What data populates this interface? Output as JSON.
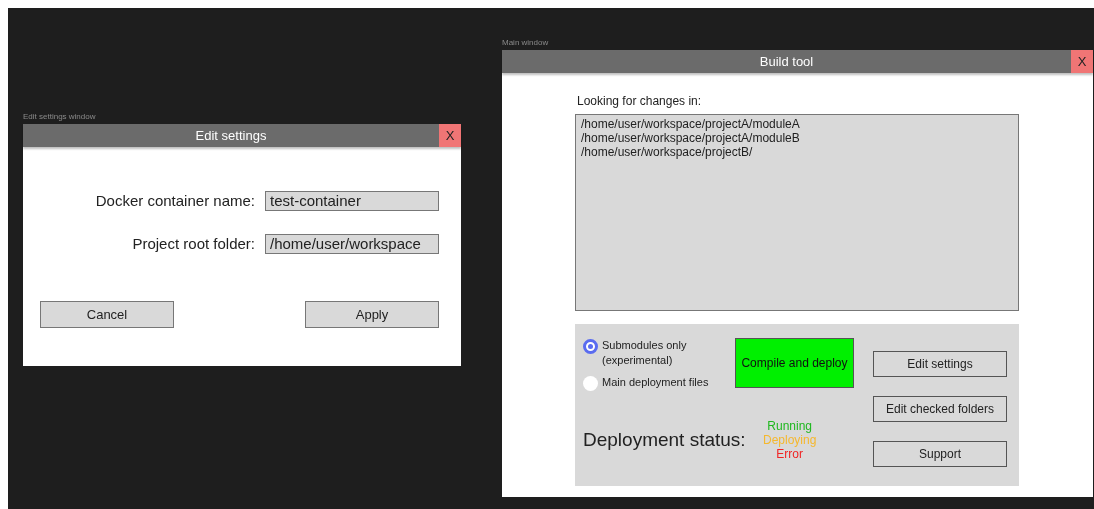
{
  "settings_window": {
    "canvas_label": "Edit settings window",
    "title": "Edit settings",
    "close": "X",
    "fields": [
      {
        "label": "Docker container name:",
        "value": "test-container"
      },
      {
        "label": "Project root folder:",
        "value": "/home/user/workspace"
      }
    ],
    "buttons": [
      "Cancel",
      "Apply"
    ]
  },
  "main_window": {
    "canvas_label": "Main window",
    "title": "Build tool",
    "close": "X",
    "folders_label": "Looking for changes in:",
    "folders": [
      "/home/user/workspace/projectA/moduleA",
      "/home/user/workspace/projectA/moduleB",
      "/home/user/workspace/projectB/"
    ],
    "modes": [
      {
        "label": "Submodules only (experimental)",
        "selected": true
      },
      {
        "label": "Main deployment files",
        "selected": false
      }
    ],
    "compile_button": "Compile and deploy",
    "side_buttons": [
      "Edit settings",
      "Edit checked folders",
      "Support"
    ],
    "status_label": "Deployment status:",
    "statuses": [
      {
        "text": "Running",
        "color": "#1fb81f"
      },
      {
        "text": "Deploying",
        "color": "#f5b82e"
      },
      {
        "text": "Error",
        "color": "#f02424"
      }
    ]
  }
}
